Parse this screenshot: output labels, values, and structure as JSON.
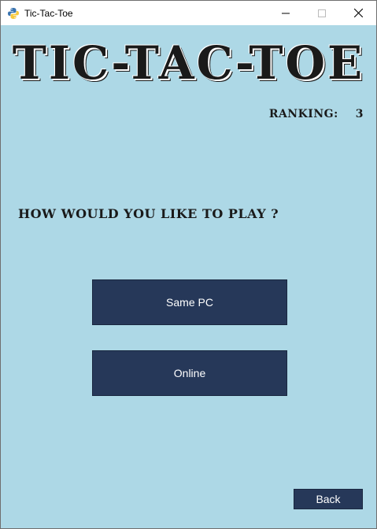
{
  "window": {
    "title": "Tic-Tac-Toe",
    "icon": "python-icon",
    "controls": [
      "minimize-icon",
      "maximize-icon",
      "close-icon"
    ]
  },
  "header": {
    "game_title": "TIC-TAC-TOE"
  },
  "ranking": {
    "label": "RANKING:",
    "value": "3"
  },
  "main": {
    "prompt": "HOW WOULD YOU LIKE TO PLAY ?",
    "buttons": {
      "same_pc": "Same PC",
      "online": "Online"
    }
  },
  "footer": {
    "back_label": "Back"
  },
  "colors": {
    "background": "#add8e6",
    "button": "#263859",
    "button_text": "#ffffff",
    "text": "#1a1a1a"
  }
}
